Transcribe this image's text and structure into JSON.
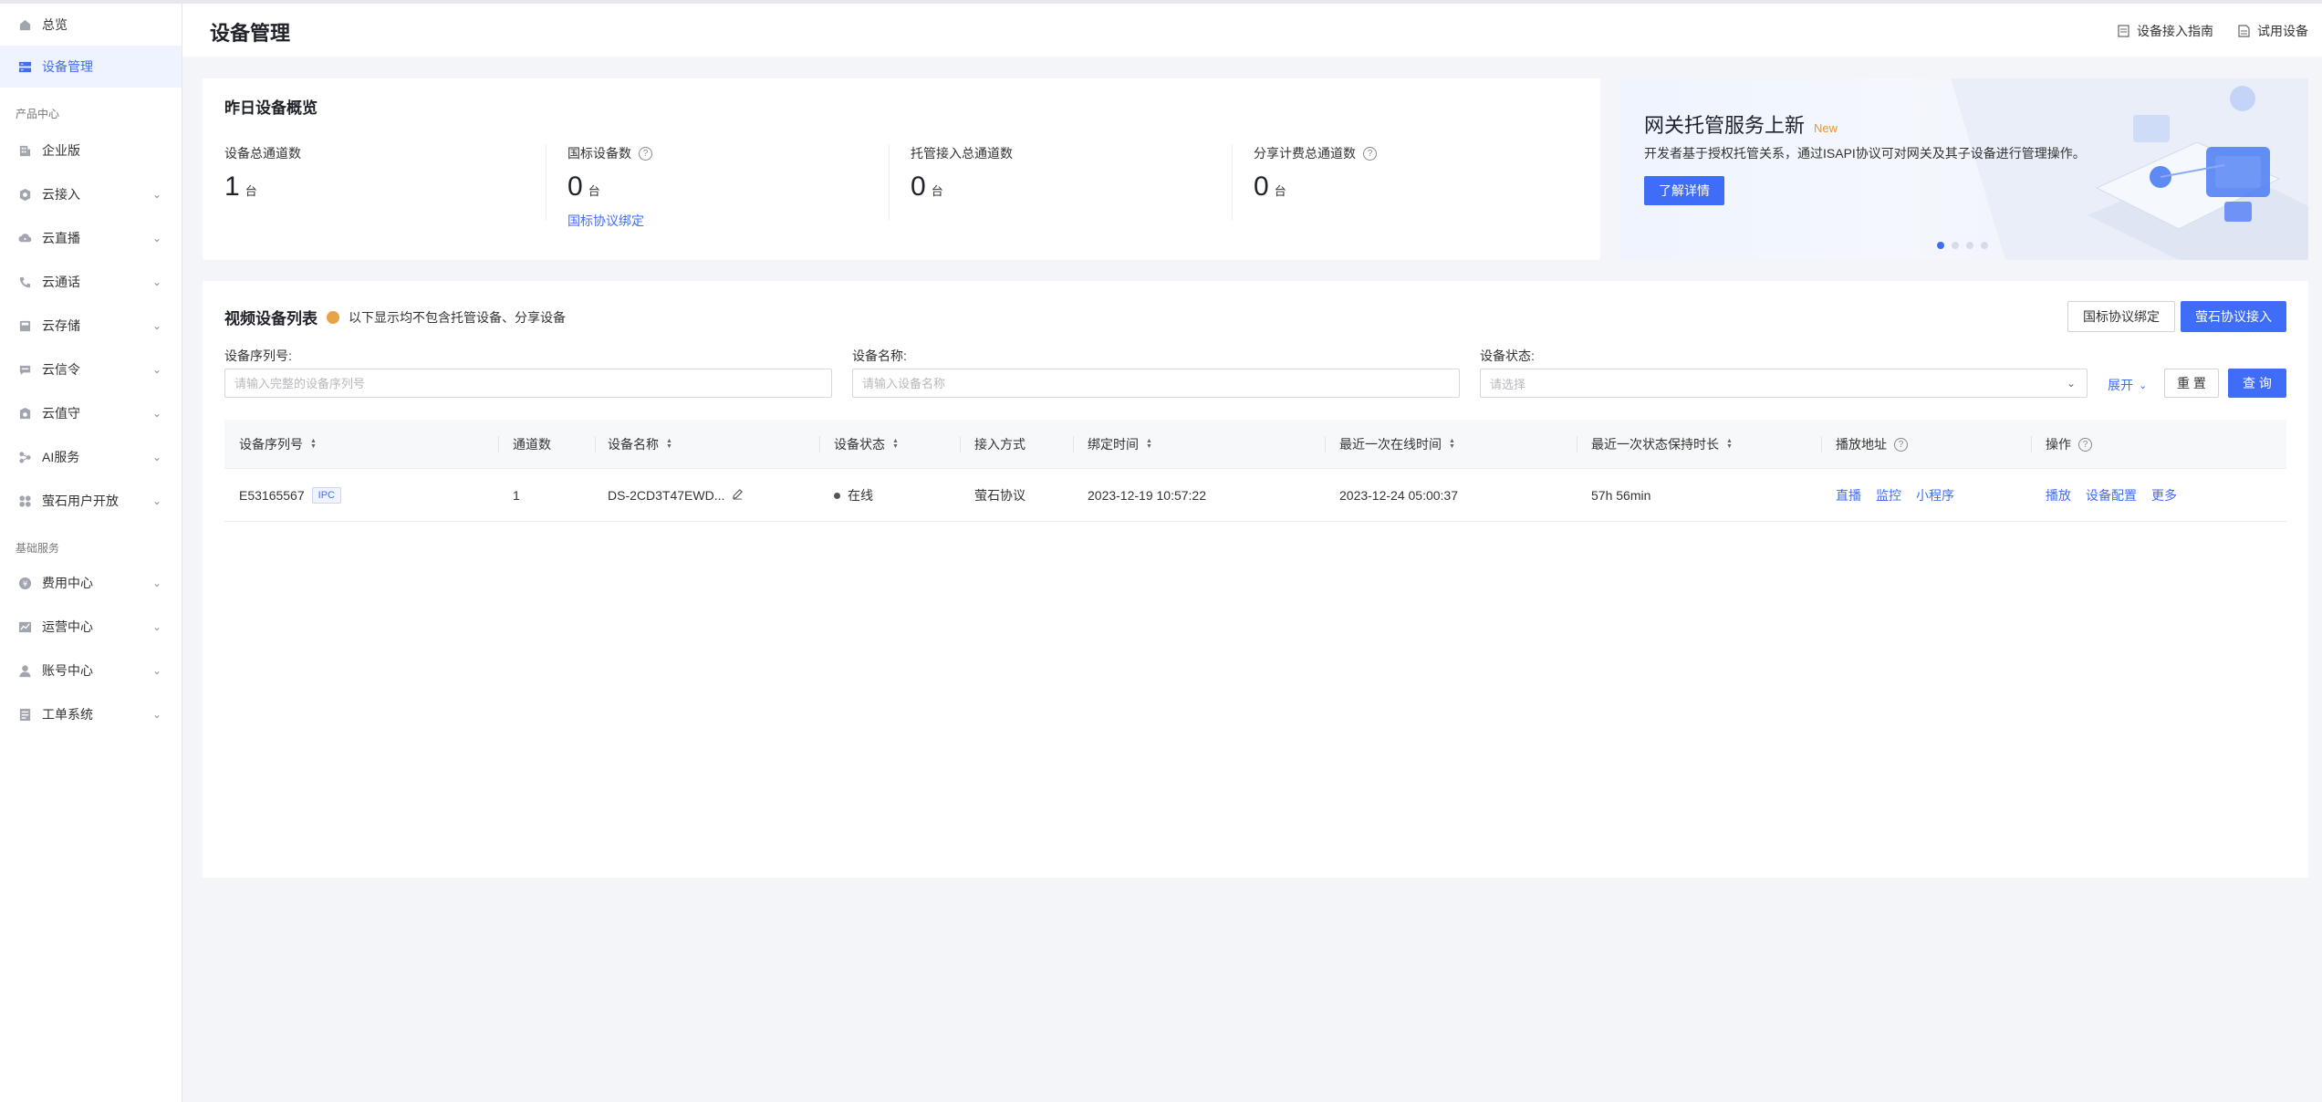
{
  "sidebar": {
    "items_top": [
      {
        "label": "总览",
        "icon": "home-icon"
      },
      {
        "label": "设备管理",
        "icon": "device-icon",
        "active": true
      }
    ],
    "section_product": "产品中心",
    "product_items": [
      {
        "label": "企业版",
        "icon": "building-icon"
      },
      {
        "label": "云接入",
        "icon": "cloud-access-icon"
      },
      {
        "label": "云直播",
        "icon": "cloud-live-icon"
      },
      {
        "label": "云通话",
        "icon": "phone-icon"
      },
      {
        "label": "云存储",
        "icon": "storage-icon"
      },
      {
        "label": "云信令",
        "icon": "message-icon"
      },
      {
        "label": "云值守",
        "icon": "shield-icon"
      },
      {
        "label": "AI服务",
        "icon": "ai-icon"
      },
      {
        "label": "萤石用户开放",
        "icon": "apps-icon"
      }
    ],
    "section_basic": "基础服务",
    "basic_items": [
      {
        "label": "费用中心",
        "icon": "yen-icon"
      },
      {
        "label": "运营中心",
        "icon": "chart-icon"
      },
      {
        "label": "账号中心",
        "icon": "user-icon"
      },
      {
        "label": "工单系统",
        "icon": "ticket-icon"
      }
    ]
  },
  "header": {
    "title": "设备管理",
    "guide_link": "设备接入指南",
    "trial_link": "试用设备"
  },
  "overview": {
    "title": "昨日设备概览",
    "stats": [
      {
        "label": "设备总通道数",
        "value": "1",
        "unit": "台"
      },
      {
        "label": "国标设备数",
        "value": "0",
        "unit": "台",
        "link": "国标协议绑定"
      },
      {
        "label": "托管接入总通道数",
        "value": "0",
        "unit": "台"
      },
      {
        "label": "分享计费总通道数",
        "value": "0",
        "unit": "台"
      }
    ]
  },
  "banner": {
    "title": "网关托管服务上新",
    "badge": "New",
    "description": "开发者基于授权托管关系，通过ISAPI协议可对网关及其子设备进行管理操作。",
    "button": "了解详情",
    "slide_count": 4,
    "active_slide": 1
  },
  "list": {
    "title": "视频设备列表",
    "notice": "以下显示均不包含托管设备、分享设备",
    "gb_bind_button": "国标协议绑定",
    "ezviz_access_button": "萤石协议接入",
    "filters": {
      "serial_label": "设备序列号:",
      "serial_placeholder": "请输入完整的设备序列号",
      "name_label": "设备名称:",
      "name_placeholder": "请输入设备名称",
      "status_label": "设备状态:",
      "status_placeholder": "请选择",
      "expand": "展开",
      "reset": "重 置",
      "query": "查 询"
    },
    "columns": [
      "设备序列号",
      "通道数",
      "设备名称",
      "设备状态",
      "接入方式",
      "绑定时间",
      "最近一次在线时间",
      "最近一次状态保持时长",
      "播放地址",
      "操作"
    ],
    "rows": [
      {
        "serial": "E53165567",
        "tag": "IPC",
        "channels": "1",
        "name": "DS-2CD3T47EWD...",
        "status": "在线",
        "access": "萤石协议",
        "bind_time": "2023-12-19 10:57:22",
        "last_online": "2023-12-24 05:00:37",
        "duration": "57h 56min",
        "play": [
          "直播",
          "监控",
          "小程序"
        ],
        "ops": [
          "播放",
          "设备配置",
          "更多"
        ]
      }
    ]
  },
  "colors": {
    "primary": "#3f6df7",
    "active_bg": "#eef3ff",
    "notice_dot": "#e8a34a",
    "badge_new": "#f0932b"
  }
}
